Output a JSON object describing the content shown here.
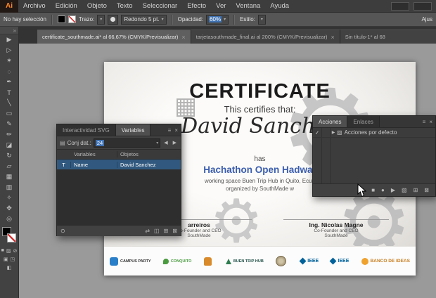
{
  "app": {
    "logo": "Ai"
  },
  "menubar": {
    "items": [
      "Archivo",
      "Edición",
      "Objeto",
      "Texto",
      "Seleccionar",
      "Efecto",
      "Ver",
      "Ventana",
      "Ayuda"
    ]
  },
  "controlbar": {
    "selection_status": "No hay selección",
    "stroke_label": "Trazo:",
    "brush_value": "Redondo 5 pt.",
    "opacity_label": "Opacidad:",
    "opacity_value": "60%",
    "style_label": "Estilo:",
    "align_label": "Ajus",
    "fill_color": "#000000",
    "stroke_swatch": "red-slash-none"
  },
  "tabbar": {
    "tabs": [
      {
        "label": "certificate_southmade.ai* al 66,67% (CMYK/Previsualizar)",
        "close": "×"
      },
      {
        "label": "tarjetasouthmade_final.ai al 200% (CMYK/Previsualizar)",
        "close": "×"
      },
      {
        "label": "Sin título-1* al 68",
        "close": ""
      }
    ]
  },
  "toolbar": {
    "collapse": "»",
    "tools": [
      {
        "name": "selection",
        "glyph": "▶"
      },
      {
        "name": "direct-selection",
        "glyph": "▷"
      },
      {
        "name": "magic-wand",
        "glyph": "✶"
      },
      {
        "name": "lasso",
        "glyph": "◌"
      },
      {
        "name": "pen",
        "glyph": "✒"
      },
      {
        "name": "type",
        "glyph": "T"
      },
      {
        "name": "line-segment",
        "glyph": "╲"
      },
      {
        "name": "rectangle",
        "glyph": "▭"
      },
      {
        "name": "paintbrush",
        "glyph": "✎"
      },
      {
        "name": "pencil",
        "glyph": "✏"
      },
      {
        "name": "eraser",
        "glyph": "◪"
      },
      {
        "name": "rotate",
        "glyph": "↻"
      },
      {
        "name": "scale",
        "glyph": "▱"
      },
      {
        "name": "mesh",
        "glyph": "▦"
      },
      {
        "name": "gradient",
        "glyph": "▥"
      },
      {
        "name": "eyedropper",
        "glyph": "✧"
      },
      {
        "name": "hand",
        "glyph": "✥"
      },
      {
        "name": "zoom",
        "glyph": "◎"
      }
    ],
    "modes": {
      "color": "■",
      "gradient": "▨",
      "none": "⊘",
      "normal": "▣",
      "behind": "◳",
      "screen": "◧"
    }
  },
  "certificate": {
    "title": "CERTIFICATE",
    "subtitle": "This certifies that:",
    "recipient": "David Sanchez",
    "connector": "has",
    "event": "Hachathon Open Hadwar",
    "detail_line1": "working space Buen Trip Hub in Quito, Ecua",
    "detail_line2": "organized by SouthMade w",
    "signature_left": {
      "name": "arreiros",
      "role": "Co-Founder and CEO",
      "org": "SouthMade"
    },
    "signature_right": {
      "name": "Ing. Nicolas Magne",
      "role": "Co-Founder and CEO",
      "org": "SouthMade"
    },
    "sponsors": [
      {
        "label": "CAMPUS PARTY"
      },
      {
        "label": "CONQUITO"
      },
      {
        "label": ""
      },
      {
        "label": "BUEN TRIP HUB"
      },
      {
        "label": ""
      },
      {
        "label": "IEEE"
      },
      {
        "label": "IEEE"
      },
      {
        "label": "BANCO DE IDEAS"
      }
    ]
  },
  "panel_chrome": {
    "menu_icon": "≡",
    "close_icon": "×"
  },
  "variables_panel": {
    "tabs": [
      "Interactividad SVG",
      "Variables"
    ],
    "dataset_icon": "▤",
    "dataset_label": "Conj dat.:",
    "dataset_value": "24",
    "nav_prev": "◀",
    "nav_next": "▶",
    "columns": {
      "type": "",
      "variables": "Variables",
      "objects": "Objetos"
    },
    "rows": [
      {
        "type_icon": "T",
        "variable": "Name",
        "object": "David Sanchez"
      }
    ],
    "buttons": {
      "lock": "⊙",
      "swap": "⇄",
      "duplicate": "◫",
      "new": "⊞",
      "delete": "⊠"
    }
  },
  "actions_panel": {
    "tabs": [
      "Acciones",
      "Enlaces"
    ],
    "rows": [
      {
        "check": "✓",
        "expand": "▶",
        "folder": "▧",
        "label": "Acciones por defecto"
      }
    ],
    "buttons": {
      "stop": "■",
      "record": "●",
      "play": "▶",
      "new_set": "▧",
      "new_action": "⊞",
      "delete": "⊠"
    }
  }
}
